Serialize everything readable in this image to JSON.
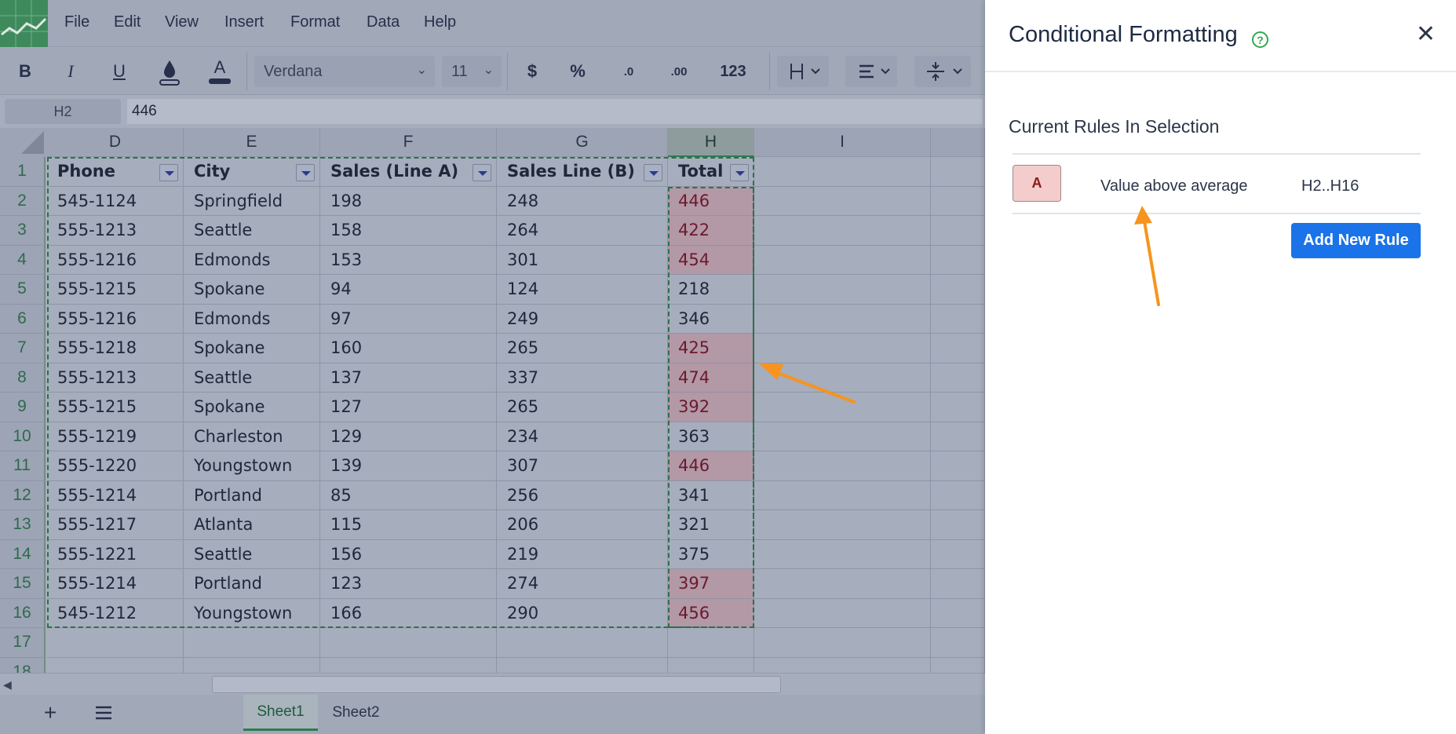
{
  "menu": [
    "File",
    "Edit",
    "View",
    "Insert",
    "Format",
    "Data",
    "Help"
  ],
  "toolbar": {
    "bold": "B",
    "italic": "I",
    "underline": "U",
    "font_color": "A",
    "font_family": "Verdana",
    "font_size": "11",
    "currency": "$",
    "percent": "%",
    "decrease_decimal": ".0",
    "increase_decimal": ".00",
    "number_format": "123"
  },
  "formula_bar": {
    "cell_ref": "H2",
    "value": "446"
  },
  "columns": [
    "D",
    "E",
    "F",
    "G",
    "H",
    "I"
  ],
  "header_row": [
    "Phone",
    "City",
    "Sales (Line A)",
    "Sales Line (B)",
    "Total"
  ],
  "rows": [
    {
      "n": "2",
      "cells": [
        "545-1124",
        "Springfield",
        "198",
        "248",
        "446"
      ],
      "hl": true
    },
    {
      "n": "3",
      "cells": [
        "555-1213",
        "Seattle",
        "158",
        "264",
        "422"
      ],
      "hl": true
    },
    {
      "n": "4",
      "cells": [
        "555-1216",
        "Edmonds",
        "153",
        "301",
        "454"
      ],
      "hl": true
    },
    {
      "n": "5",
      "cells": [
        "555-1215",
        "Spokane",
        "94",
        "124",
        "218"
      ],
      "hl": false
    },
    {
      "n": "6",
      "cells": [
        "555-1216",
        "Edmonds",
        "97",
        "249",
        "346"
      ],
      "hl": false
    },
    {
      "n": "7",
      "cells": [
        "555-1218",
        "Spokane",
        "160",
        "265",
        "425"
      ],
      "hl": true
    },
    {
      "n": "8",
      "cells": [
        "555-1213",
        "Seattle",
        "137",
        "337",
        "474"
      ],
      "hl": true
    },
    {
      "n": "9",
      "cells": [
        "555-1215",
        "Spokane",
        "127",
        "265",
        "392"
      ],
      "hl": true
    },
    {
      "n": "10",
      "cells": [
        "555-1219",
        "Charleston",
        "129",
        "234",
        "363"
      ],
      "hl": false
    },
    {
      "n": "11",
      "cells": [
        "555-1220",
        "Youngstown",
        "139",
        "307",
        "446"
      ],
      "hl": true
    },
    {
      "n": "12",
      "cells": [
        "555-1214",
        "Portland",
        "85",
        "256",
        "341"
      ],
      "hl": false
    },
    {
      "n": "13",
      "cells": [
        "555-1217",
        "Atlanta",
        "115",
        "206",
        "321"
      ],
      "hl": false
    },
    {
      "n": "14",
      "cells": [
        "555-1221",
        "Seattle",
        "156",
        "219",
        "375"
      ],
      "hl": false
    },
    {
      "n": "15",
      "cells": [
        "555-1214",
        "Portland",
        "123",
        "274",
        "397"
      ],
      "hl": true
    },
    {
      "n": "16",
      "cells": [
        "545-1212",
        "Youngstown",
        "166",
        "290",
        "456"
      ],
      "hl": true
    }
  ],
  "extra_rows": [
    "1",
    "17",
    "18"
  ],
  "sheets": [
    "Sheet1",
    "Sheet2"
  ],
  "active_sheet": "Sheet1",
  "panel": {
    "title": "Conditional Formatting",
    "help": "?",
    "close": "✕",
    "rules_heading": "Current Rules In Selection",
    "rule": {
      "swatch": "A",
      "description": "Value above average",
      "range": "H2..H16"
    },
    "add_button": "Add New Rule"
  },
  "colors": {
    "highlight_fill": "#f4cccc",
    "highlight_text": "#8b1a1a",
    "accent": "#1a73e8",
    "annotation": "#f7941d"
  }
}
